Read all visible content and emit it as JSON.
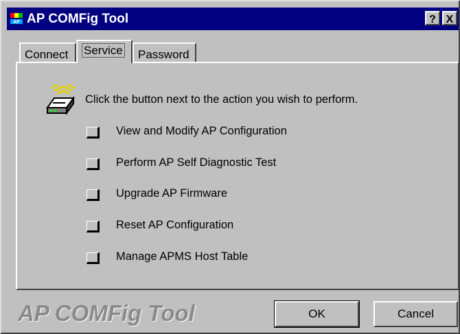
{
  "window": {
    "title": "AP COMFig Tool",
    "help_button": "?",
    "close_button": "X"
  },
  "tabs": [
    {
      "label": "Connect",
      "active": false
    },
    {
      "label": "Service",
      "active": true
    },
    {
      "label": "Password",
      "active": false
    }
  ],
  "service": {
    "instruction": "Click the button next to the action you wish to perform.",
    "actions": [
      {
        "label": "View and Modify AP Configuration"
      },
      {
        "label": "Perform AP Self Diagnostic Test"
      },
      {
        "label": "Upgrade AP Firmware"
      },
      {
        "label": "Reset AP Configuration"
      },
      {
        "label": "Manage APMS Host Table"
      }
    ]
  },
  "footer": {
    "brand": "AP COMFig Tool",
    "ok_label": "OK",
    "cancel_label": "Cancel"
  },
  "colors": {
    "titlebar": "#000080",
    "face": "#c0c0c0",
    "watermark": "#8a8a8a"
  },
  "icons": {
    "app": "ap-app-icon",
    "panel": "wireless-access-point-icon"
  }
}
